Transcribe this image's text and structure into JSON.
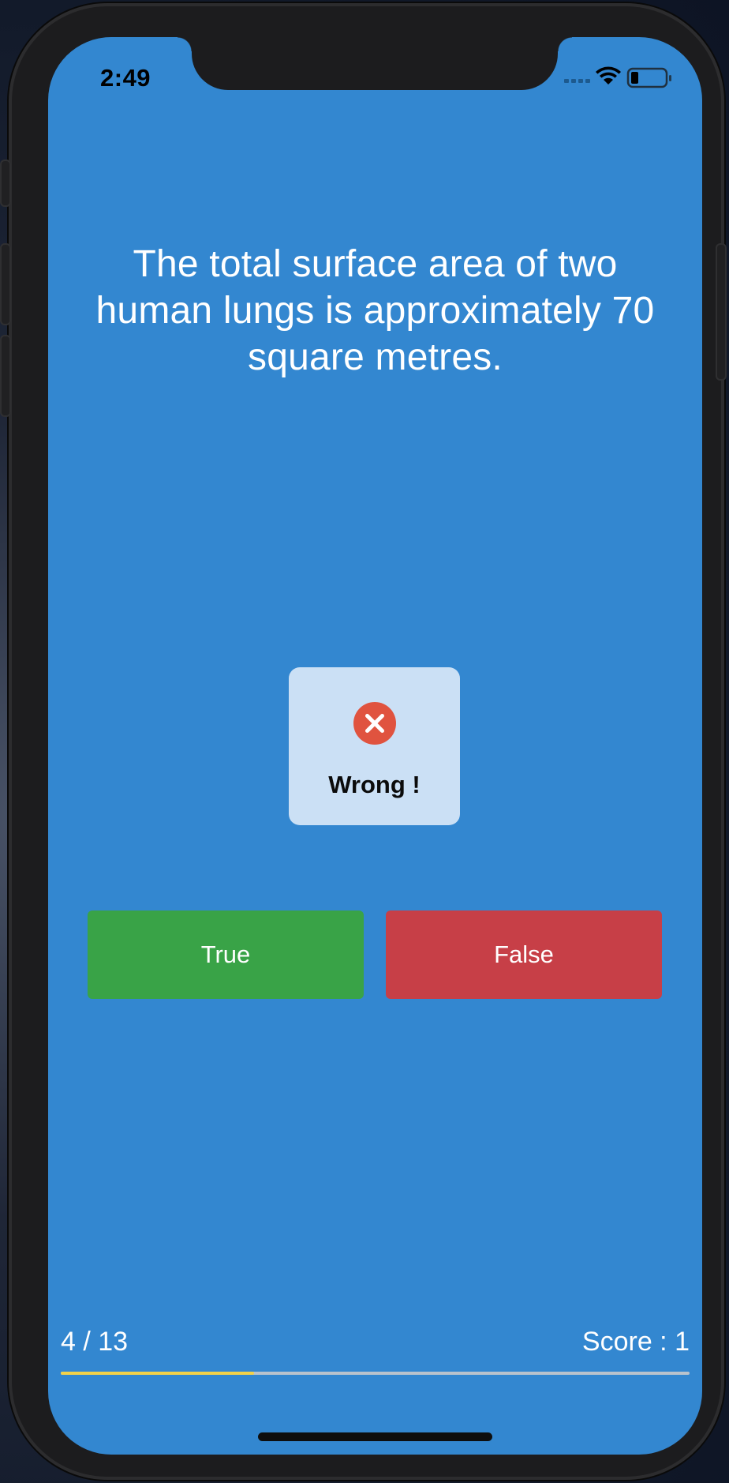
{
  "status_bar": {
    "time": "2:49",
    "cellular_icon": "cellular-signal-icon",
    "wifi_icon": "wifi-icon",
    "battery_icon": "battery-icon"
  },
  "question": {
    "text": "The total surface area of two human lungs is approximately 70 square metres."
  },
  "feedback": {
    "icon": "wrong-x-icon",
    "label": "Wrong !",
    "icon_color": "#e0533f"
  },
  "answers": {
    "true_label": "True",
    "false_label": "False",
    "true_color": "#39a347",
    "false_color": "#c73f47"
  },
  "progress": {
    "label": "4 / 13",
    "current": 4,
    "total": 13,
    "fill_color": "#f2d24a"
  },
  "score": {
    "label": "Score : 1"
  },
  "theme": {
    "background": "#3387d0"
  }
}
